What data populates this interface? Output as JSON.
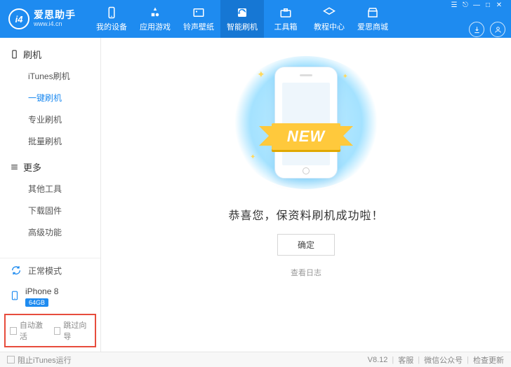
{
  "brand": {
    "badge": "i4",
    "title": "爱思助手",
    "sub": "www.i4.cn"
  },
  "nav": [
    {
      "label": "我的设备"
    },
    {
      "label": "应用游戏"
    },
    {
      "label": "铃声壁纸"
    },
    {
      "label": "智能刷机"
    },
    {
      "label": "工具箱"
    },
    {
      "label": "教程中心"
    },
    {
      "label": "爱思商城"
    }
  ],
  "sidebar": {
    "group1": {
      "title": "刷机",
      "items": [
        "iTunes刷机",
        "一键刷机",
        "专业刷机",
        "批量刷机"
      ]
    },
    "group2": {
      "title": "更多",
      "items": [
        "其他工具",
        "下载固件",
        "高级功能"
      ]
    }
  },
  "status": {
    "mode": "正常模式"
  },
  "device": {
    "name": "iPhone 8",
    "capacity": "64GB"
  },
  "checks": {
    "auto_activate": "自动激活",
    "skip_wizard": "跳过向导"
  },
  "hero": {
    "ribbon": "NEW"
  },
  "main": {
    "message": "恭喜您，保资料刷机成功啦！",
    "ok": "确定",
    "log": "查看日志"
  },
  "footer": {
    "block_itunes": "阻止iTunes运行",
    "version": "V8.12",
    "support": "客服",
    "wechat": "微信公众号",
    "update": "检查更新"
  }
}
